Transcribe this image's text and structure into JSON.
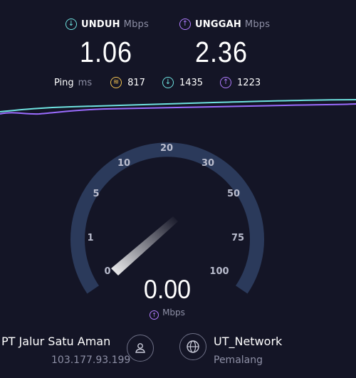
{
  "download": {
    "label": "UNDUH",
    "unit": "Mbps",
    "value": "1.06",
    "color": "#6fe3e1"
  },
  "upload": {
    "label": "UNGGAH",
    "unit": "Mbps",
    "value": "2.36",
    "color": "#b07cff"
  },
  "ping": {
    "label": "Ping",
    "unit": "ms",
    "idle": {
      "icon": "ping-idle-icon",
      "value": "817",
      "color": "#f5c451"
    },
    "download": {
      "icon": "download-arrow-icon",
      "value": "1435",
      "color": "#6fe3e1"
    },
    "upload": {
      "icon": "upload-arrow-icon",
      "value": "1223",
      "color": "#b07cff"
    }
  },
  "graph": {
    "download_color": "#6fe3e1",
    "upload_color": "#9b6cff"
  },
  "gauge": {
    "ticks": [
      "0",
      "1",
      "5",
      "10",
      "20",
      "30",
      "50",
      "75",
      "100"
    ],
    "value": "0.00",
    "unit": "Mbps",
    "unit_icon": "upload-arrow-icon",
    "track_color": "#2b3a5b"
  },
  "isp": {
    "name": "PT Jalur Satu Aman",
    "ip": "103.177.93.199",
    "icon": "user-icon"
  },
  "server": {
    "name": "UT_Network",
    "location": "Pemalang",
    "icon": "globe-icon"
  }
}
